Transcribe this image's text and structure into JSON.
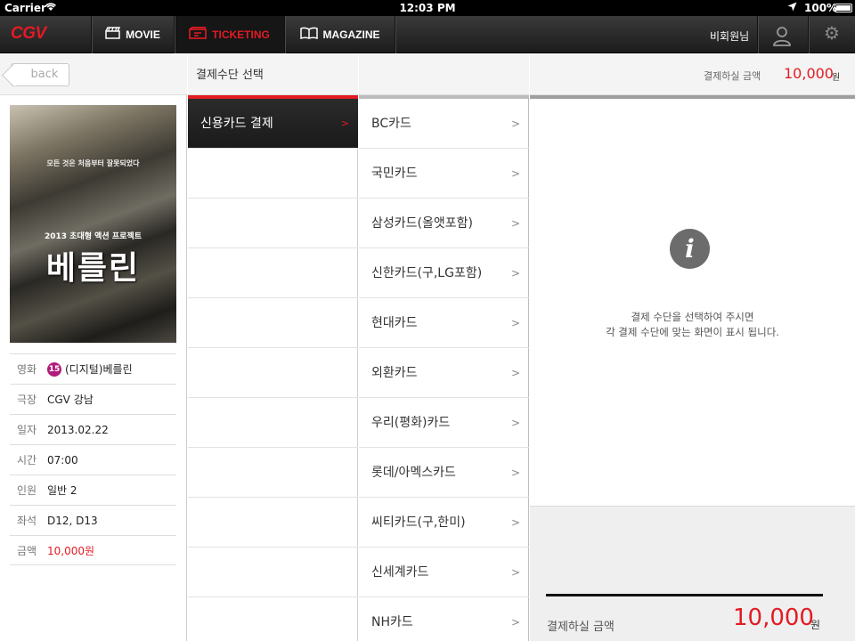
{
  "status_bar": {
    "carrier": "Carrier",
    "time": "12:03 PM",
    "battery": "100%"
  },
  "nav": {
    "logo": "CGV",
    "items": [
      {
        "label": "MOVIE",
        "icon": "clapper-icon"
      },
      {
        "label": "TICKETING",
        "icon": "ticket-icon"
      },
      {
        "label": "MAGAZINE",
        "icon": "book-icon"
      }
    ],
    "user_label": "비회원님",
    "accent": "#e31b23"
  },
  "left": {
    "back_label": "back",
    "poster": {
      "tagline": "모든 것은 처음부터 잘못되었다",
      "subtitle": "2013 초대형 액션 프로젝트",
      "title": "베를린"
    },
    "info": [
      {
        "key": "영화",
        "value": "(디지털)베를린",
        "rating": "15"
      },
      {
        "key": "극장",
        "value": "CGV 강남"
      },
      {
        "key": "일자",
        "value": "2013.02.22"
      },
      {
        "key": "시간",
        "value": "07:00"
      },
      {
        "key": "인원",
        "value": "일반 2"
      },
      {
        "key": "좌석",
        "value": "D12, D13"
      },
      {
        "key": "금액",
        "value": "10,000원"
      }
    ]
  },
  "methods": {
    "header": "결제수단 선택",
    "selected": "신용카드 결제"
  },
  "cards": [
    "BC카드",
    "국민카드",
    "삼성카드(올앳포함)",
    "신한카드(구,LG포함)",
    "현대카드",
    "외환카드",
    "우리(평화)카드",
    "롯데/아멕스카드",
    "씨티카드(구,한미)",
    "신세계카드",
    "NH카드"
  ],
  "detail": {
    "amount_label": "결제하실 금액",
    "amount": "10,000",
    "won": "원",
    "message_line1": "결제 수단을 선택하여 주시면",
    "message_line2": "각 결제 수단에 맞는 화면이 표시 됩니다."
  }
}
